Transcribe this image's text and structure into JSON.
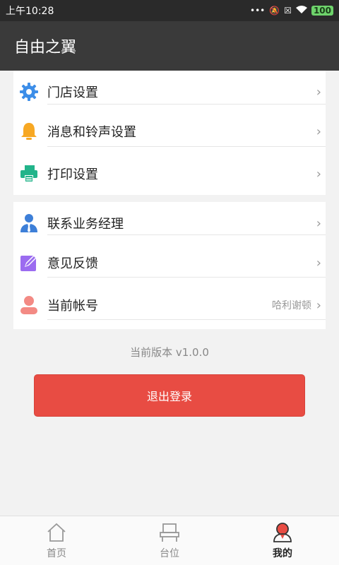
{
  "status_bar": {
    "time": "上午10:28",
    "battery": "100"
  },
  "app_bar": {
    "title": "自由之翼"
  },
  "menu_group_1": [
    {
      "label": "门店设置",
      "icon": "gear-icon"
    },
    {
      "label": "消息和铃声设置",
      "icon": "bell-icon"
    },
    {
      "label": "打印设置",
      "icon": "printer-icon"
    }
  ],
  "menu_group_2": [
    {
      "label": "联系业务经理",
      "icon": "manager-icon"
    },
    {
      "label": "意见反馈",
      "icon": "feedback-icon"
    },
    {
      "label": "当前帐号",
      "icon": "user-icon",
      "value": "哈利谢顿"
    }
  ],
  "version_text": "当前版本 v1.0.0",
  "logout_label": "退出登录",
  "tabs": [
    {
      "label": "首页",
      "icon": "home-icon",
      "active": false
    },
    {
      "label": "台位",
      "icon": "table-seat-icon",
      "active": false
    },
    {
      "label": "我的",
      "icon": "profile-icon",
      "active": true
    }
  ],
  "colors": {
    "accent": "#e84c43",
    "app_bar": "#3a3a3a"
  }
}
